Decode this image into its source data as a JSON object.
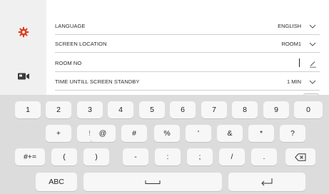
{
  "colors": {
    "accent": "#e03a1e",
    "text": "#2b2b2b",
    "divider": "#cfcfcf"
  },
  "sidebar": {
    "items": [
      {
        "icon": "gear-icon",
        "selected": true
      },
      {
        "icon": "camera-icon",
        "selected": false
      }
    ]
  },
  "settings": {
    "language": {
      "label": "LANGUAGE",
      "value": "ENGLISH",
      "control": "chevron-down-icon"
    },
    "location": {
      "label": "SCREEN LOCATION",
      "value": "ROOM1",
      "control": "chevron-down-icon"
    },
    "room_no": {
      "label": "ROOM NO",
      "value": "",
      "control": "pencil-icon"
    },
    "standby": {
      "label": "TIME UNTILL SCREEN STANDBY",
      "value": "1 MIN",
      "control": "chevron-down-icon"
    }
  },
  "keyboard": {
    "row1": [
      "1",
      "2",
      "3",
      "4",
      "5",
      "6",
      "7",
      "8",
      "9",
      "0"
    ],
    "row2": [
      "+",
      "!",
      "@",
      "#",
      "%",
      "'",
      "&",
      "*",
      "?"
    ],
    "row3_left": "#+=",
    "row3": [
      "(",
      ")",
      "-",
      ":",
      ";",
      "/",
      "."
    ],
    "backspace_icon": "backspace-icon",
    "mode_label": "ABC",
    "space_icon": "space-icon",
    "enter_icon": "enter-icon"
  }
}
